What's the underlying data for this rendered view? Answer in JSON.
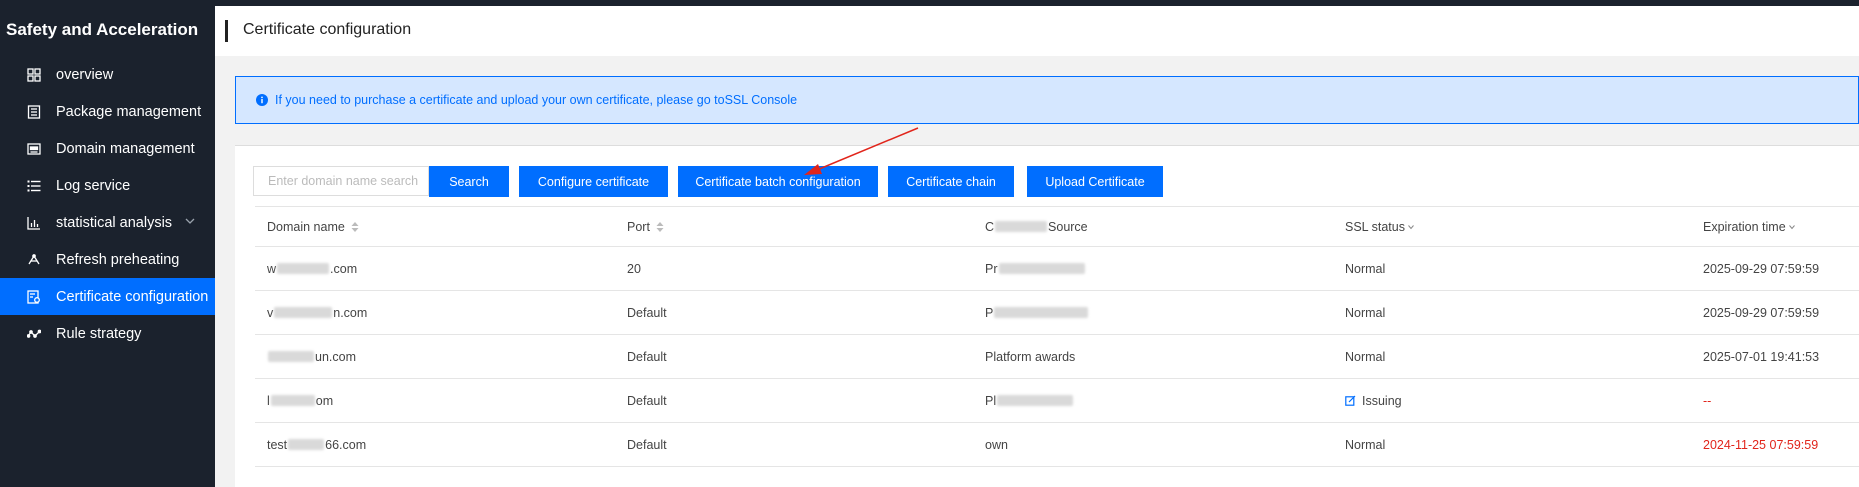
{
  "sidebar": {
    "title": "Safety and Acceleration",
    "items": [
      {
        "label": "overview",
        "icon": "grid-icon"
      },
      {
        "label": "Package management",
        "icon": "package-icon"
      },
      {
        "label": "Domain management",
        "icon": "domain-icon"
      },
      {
        "label": "Log service",
        "icon": "list-icon"
      },
      {
        "label": "statistical analysis",
        "icon": "chart-icon"
      },
      {
        "label": "Refresh preheating",
        "icon": "refresh-icon"
      },
      {
        "label": "Certificate configuration",
        "icon": "certificate-icon",
        "active": true
      },
      {
        "label": "Rule strategy",
        "icon": "strategy-icon"
      }
    ]
  },
  "header": {
    "title": "Certificate configuration"
  },
  "notice": {
    "text": "If you need to purchase a certificate and upload your own certificate, please go toSSL Console"
  },
  "toolbar": {
    "search_placeholder": "Enter domain name search",
    "search_label": "Search",
    "configure_label": "Configure certificate",
    "batch_label": "Certificate batch configuration",
    "chain_label": "Certificate chain",
    "upload_label": "Upload Certificate"
  },
  "table": {
    "columns": {
      "domain": "Domain name",
      "port": "Port",
      "source_a": "C",
      "source_b": "Source",
      "ssl": "SSL status",
      "expiration": "Expiration time"
    },
    "rows": [
      {
        "domain_a": "w",
        "domain_b": ".com",
        "port": "20",
        "source_a": "Pr",
        "source_b": "",
        "ssl": "Normal",
        "expiration": "2025-09-29 07:59:59"
      },
      {
        "domain_a": "v",
        "domain_b": "n.com",
        "port": "Default",
        "source_a": "P",
        "source_b": "",
        "ssl": "Normal",
        "expiration": "2025-09-29 07:59:59"
      },
      {
        "domain_a": "",
        "domain_b": "un.com",
        "port": "Default",
        "source_a": "Platform awards",
        "source_b": "",
        "ssl": "Normal",
        "expiration": "2025-07-01 19:41:53"
      },
      {
        "domain_a": "l",
        "domain_b": "om",
        "port": "Default",
        "source_a": "Pl",
        "source_b": "",
        "ssl": "Issuing",
        "expiration": "--"
      },
      {
        "domain_a": "test",
        "domain_b": "66.com",
        "port": "Default",
        "source_a": "own",
        "source_b": "",
        "ssl": "Normal",
        "expiration": "2024-11-25 07:59:59"
      }
    ]
  },
  "colors": {
    "accent": "#006eff",
    "sidebar_bg": "#1b222d",
    "warning": "#e1251b",
    "annotation_arrow": "#e1251b"
  }
}
